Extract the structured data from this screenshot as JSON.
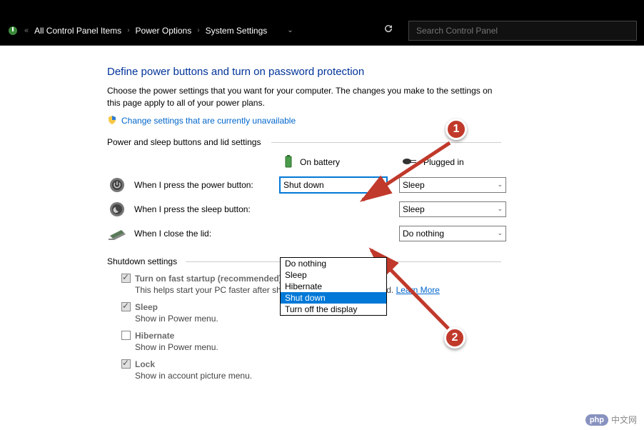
{
  "breadcrumb": {
    "item1": "All Control Panel Items",
    "item2": "Power Options",
    "item3": "System Settings"
  },
  "search": {
    "placeholder": "Search Control Panel"
  },
  "page": {
    "title": "Define power buttons and turn on password protection",
    "intro": "Choose the power settings that you want for your computer. The changes you make to the settings on this page apply to all of your power plans.",
    "uac_link": "Change settings that are currently unavailable"
  },
  "section1": {
    "header": "Power and sleep buttons and lid settings"
  },
  "cols": {
    "battery": "On battery",
    "plugged": "Plugged in"
  },
  "rows": {
    "power": {
      "label": "When I press the power button:",
      "battery": "Shut down",
      "plugged": "Sleep"
    },
    "sleep": {
      "label": "When I press the sleep button:",
      "plugged": "Sleep"
    },
    "lid": {
      "label": "When I close the lid:",
      "plugged": "Do nothing"
    }
  },
  "dropdown": {
    "options": [
      "Do nothing",
      "Sleep",
      "Hibernate",
      "Shut down",
      "Turn off the display"
    ],
    "selected": "Shut down"
  },
  "section2": {
    "header": "Shutdown settings"
  },
  "shutdown": {
    "fast": {
      "label": "Turn on fast startup (recommended)",
      "desc_a": "This helps start your PC faster after shutdown. Restart isn't affected. ",
      "learn": "Learn More",
      "checked": true
    },
    "sleep": {
      "label": "Sleep",
      "desc": "Show in Power menu.",
      "checked": true
    },
    "hiber": {
      "label": "Hibernate",
      "desc": "Show in Power menu.",
      "checked": false
    },
    "lock": {
      "label": "Lock",
      "desc": "Show in account picture menu.",
      "checked": true
    }
  },
  "annotations": {
    "badge1": "1",
    "badge2": "2"
  },
  "watermark": {
    "text": "中文网"
  }
}
